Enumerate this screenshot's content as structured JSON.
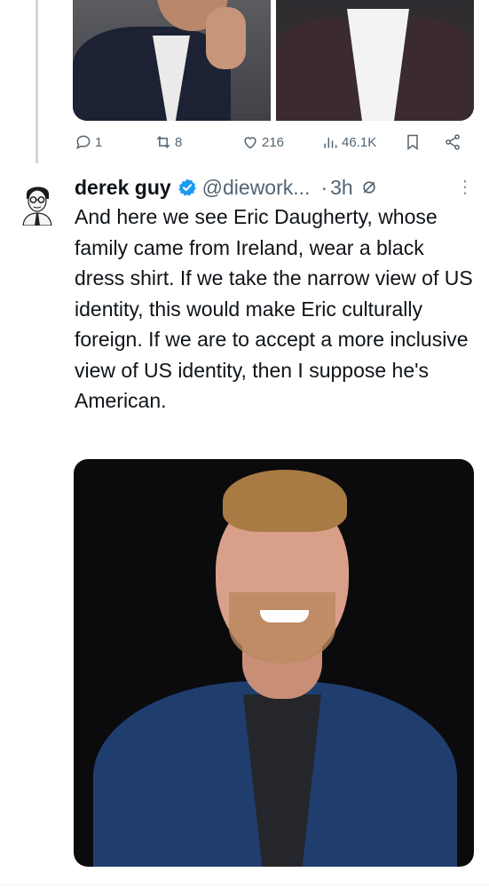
{
  "previous_tweet": {
    "actions": {
      "replies": "1",
      "retweets": "8",
      "likes": "216",
      "views": "46.1K"
    }
  },
  "tweet": {
    "author_name": "derek guy",
    "handle": "@diework...",
    "separator": "·",
    "time": "3h",
    "more": "⋮",
    "text": "And here we see Eric Daugherty, whose family came from Ireland, wear a black dress shirt. If we take the narrow view of US identity, this would make Eric culturally foreign. If we are to accept a more inclusive view of US identity, then I suppose he's American."
  },
  "colors": {
    "verified_badge": "#1d9bf0",
    "secondary_text": "#536471",
    "text": "#0f1419",
    "thread_line": "#cfd9de"
  },
  "icons": [
    "reply-icon",
    "retweet-icon",
    "like-icon",
    "views-icon",
    "bookmark-icon",
    "share-icon",
    "verified-badge-icon",
    "grok-icon",
    "more-icon"
  ]
}
